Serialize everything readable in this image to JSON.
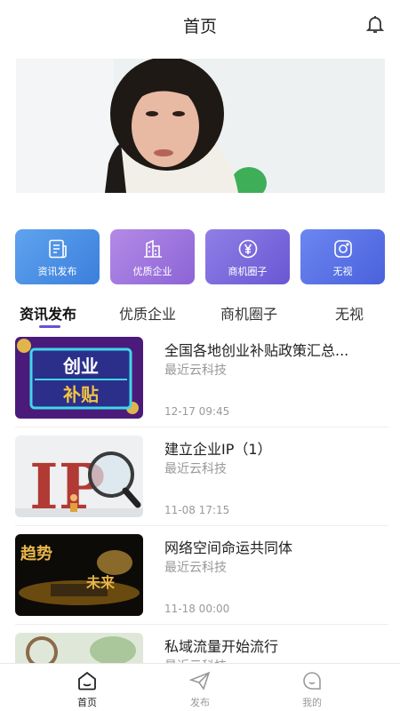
{
  "header": {
    "title": "首页",
    "bell_icon": "bell-icon"
  },
  "quick_links": [
    {
      "label": "资讯发布",
      "icon": "news-doc-icon",
      "color": "#4a8de6"
    },
    {
      "label": "优质企业",
      "icon": "building-icon",
      "color": "#9d76df"
    },
    {
      "label": "商机圈子",
      "icon": "yen-coin-icon",
      "color": "#7c6be0"
    },
    {
      "label": "无视",
      "icon": "camera-icon",
      "color": "#5b74e6"
    }
  ],
  "tabs": [
    {
      "label": "资讯发布",
      "active": true
    },
    {
      "label": "优质企业",
      "active": false
    },
    {
      "label": "商机圈子",
      "active": false
    },
    {
      "label": "无视",
      "active": false
    }
  ],
  "news": [
    {
      "title": "全国各地创业补贴政策汇总...",
      "source": "最近云科技",
      "time": "12-17 09:45",
      "thumb_text": [
        "创业",
        "补贴"
      ]
    },
    {
      "title": "建立企业IP（1）",
      "source": "最近云科技",
      "time": "11-08 17:15",
      "thumb_text": [
        "IP"
      ]
    },
    {
      "title": "网络空间命运共同体",
      "source": "最近云科技",
      "time": "11-18 00:00",
      "thumb_text": [
        "趋势",
        "未来"
      ]
    },
    {
      "title": "私域流量开始流行",
      "source": "最近云科技",
      "time": "",
      "thumb_text": []
    }
  ],
  "bottom_nav": [
    {
      "label": "首页",
      "icon": "home-icon",
      "active": true
    },
    {
      "label": "发布",
      "icon": "paper-plane-icon",
      "active": false
    },
    {
      "label": "我的",
      "icon": "profile-icon",
      "active": false
    }
  ],
  "colors": {
    "accent": "#6a4fd8",
    "muted_text": "#999999"
  }
}
